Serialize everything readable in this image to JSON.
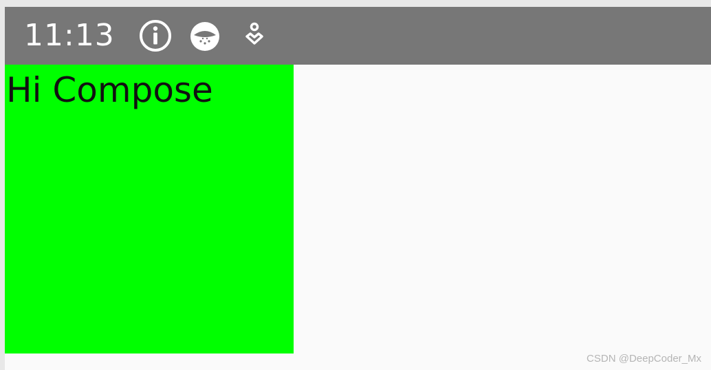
{
  "status_bar": {
    "time": "11:13",
    "background_color": "#777777",
    "icons": [
      {
        "name": "info-icon"
      },
      {
        "name": "app-notification-icon"
      },
      {
        "name": "accessibility-icon"
      }
    ]
  },
  "content": {
    "greeting_text": "Hi Compose",
    "box_color": "#00ff00"
  },
  "watermark": {
    "text": "CSDN @DeepCoder_Mx"
  }
}
